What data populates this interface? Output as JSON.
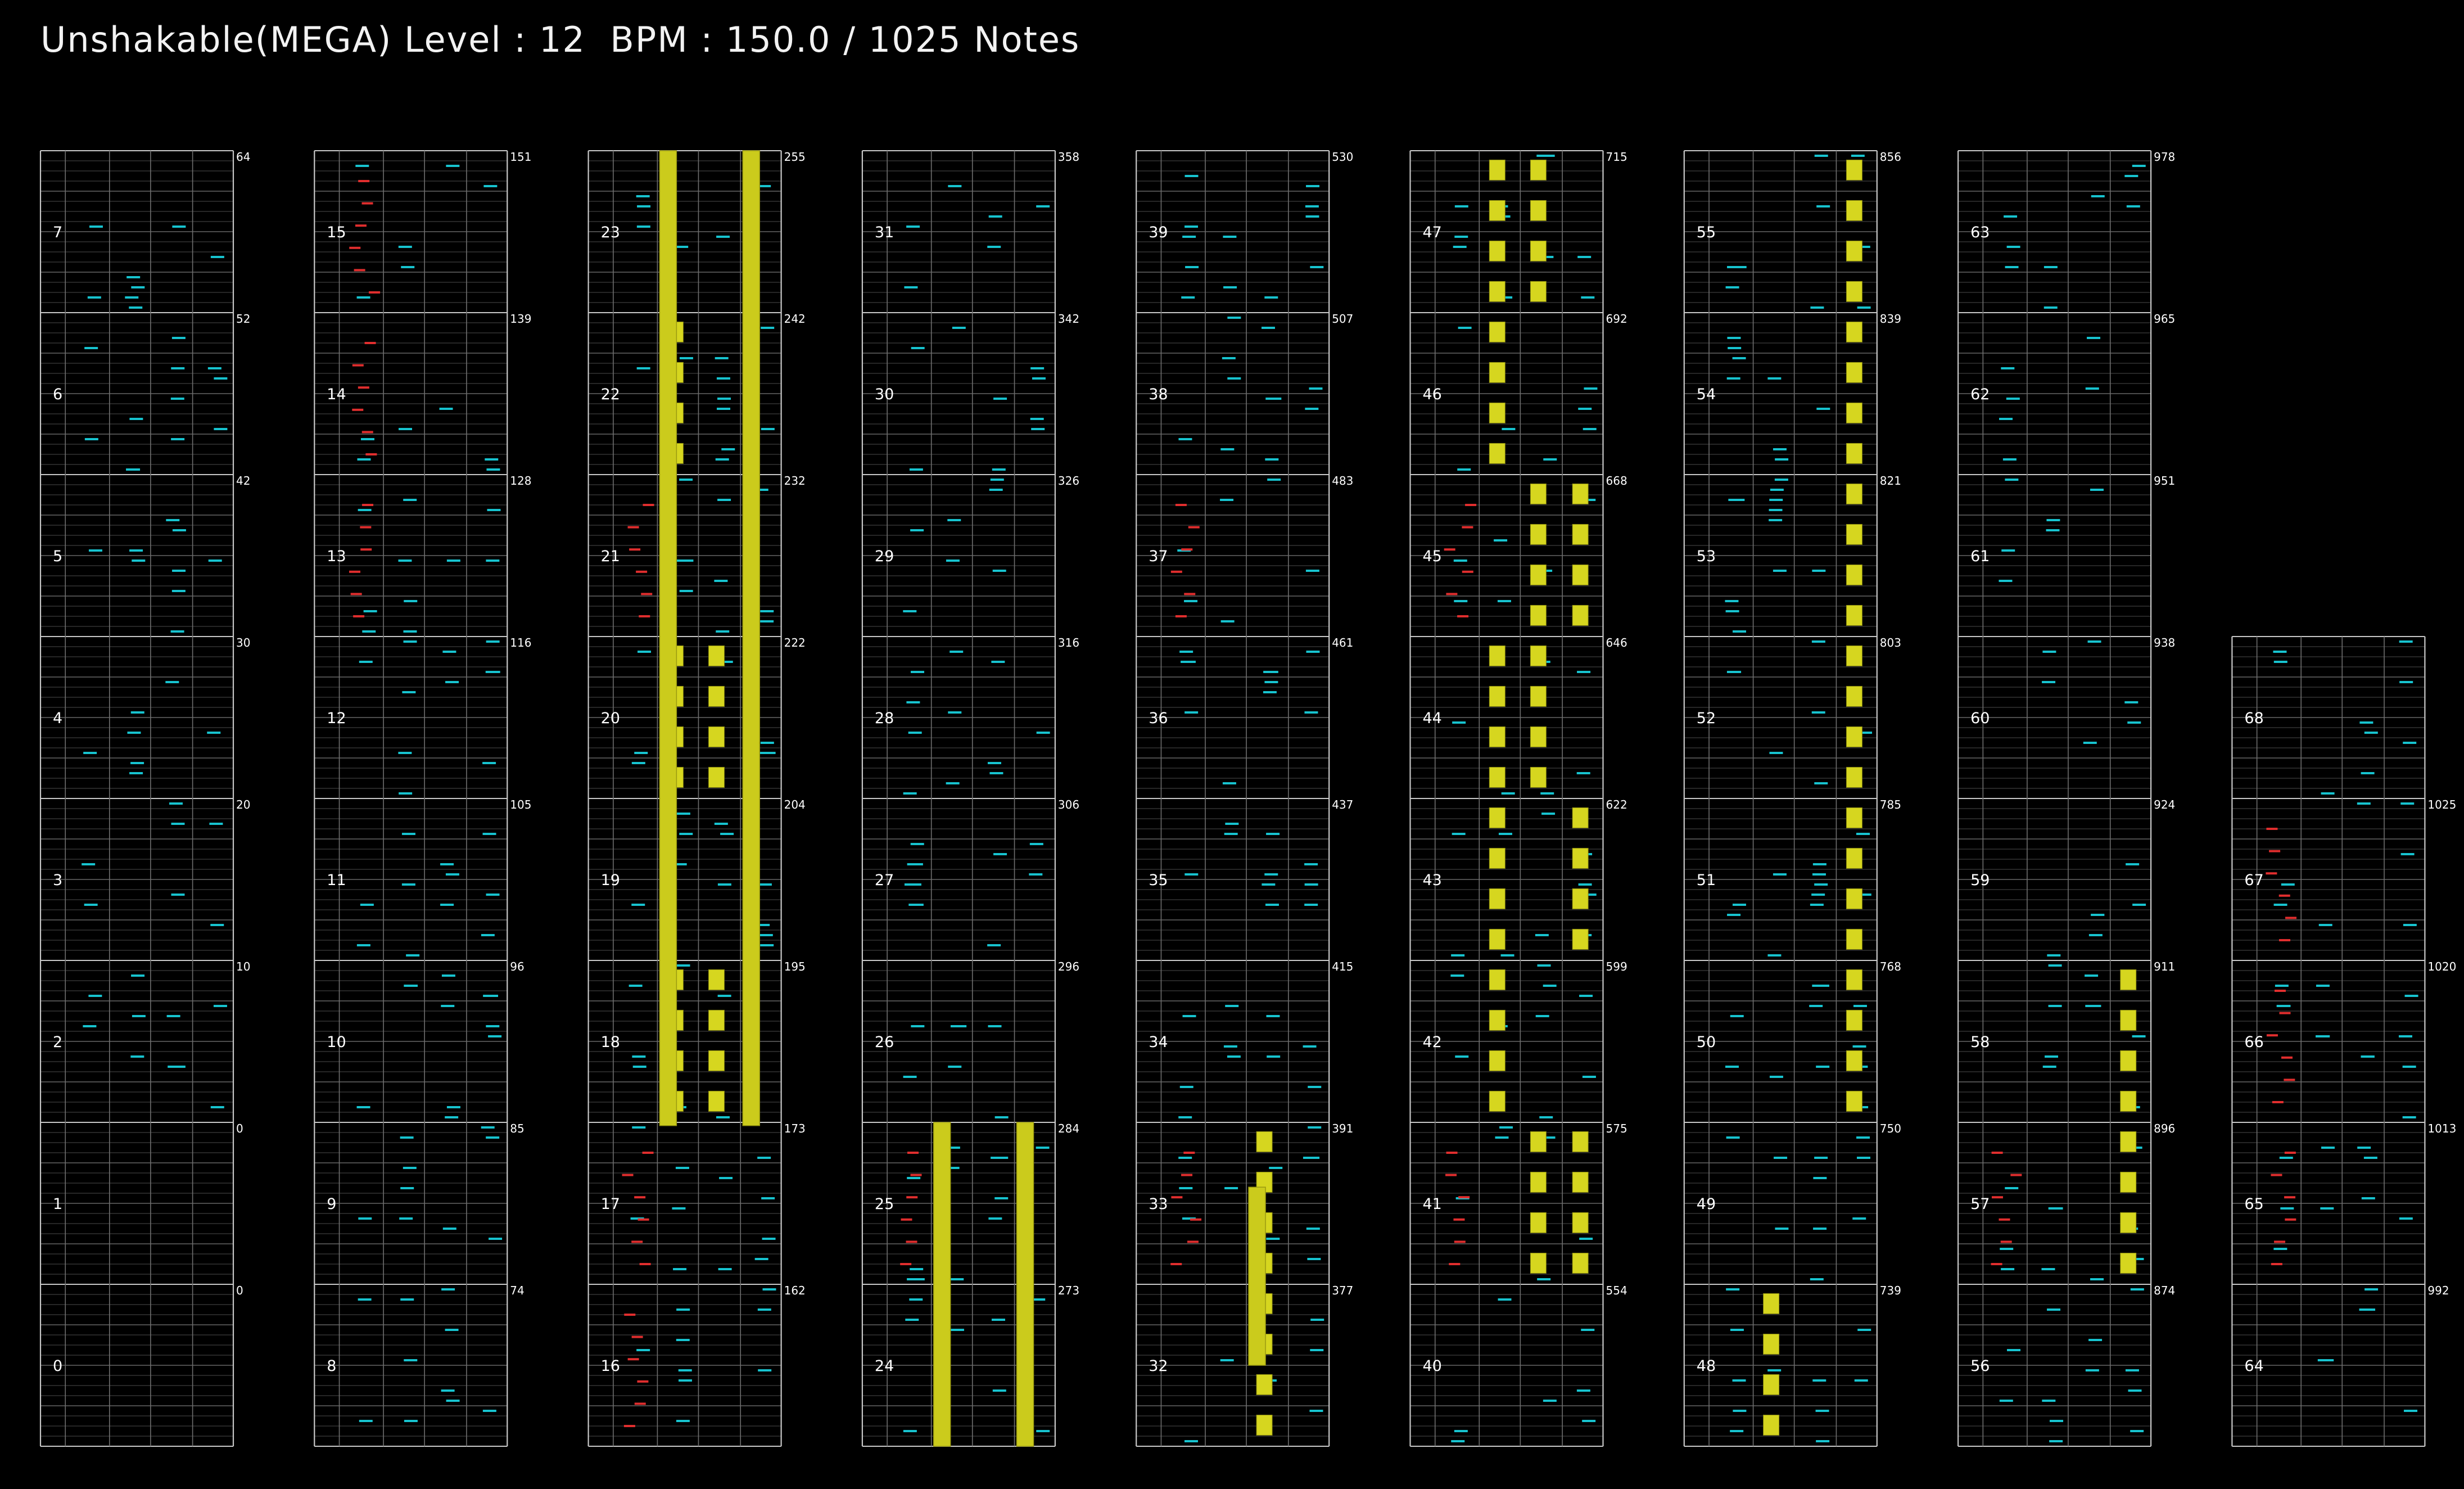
{
  "header": {
    "title": "Unshakable(MEGA) Level : 12  BPM : 150.0 / 1025 Notes",
    "song": "Unshakable(MEGA)",
    "level": 12,
    "bpm": "150.0",
    "total_notes": 1025
  },
  "colors": {
    "background": "#000000",
    "frame": "#c8c8c8",
    "beat_line": "#7a7a7a",
    "sub_line": "#3c3c3c",
    "lane_line": "#6e6e6e",
    "tap_note": "#17c3cf",
    "scratch_note": "#e02e2e",
    "long_note": "#cbcb1c",
    "landmine": "#d6d61f"
  },
  "measure_counts": [
    0,
    0,
    10,
    20,
    30,
    42,
    52,
    64,
    74,
    85,
    96,
    105,
    116,
    128,
    139,
    151,
    162,
    173,
    195,
    204,
    222,
    232,
    242,
    255,
    273,
    284,
    296,
    306,
    316,
    326,
    342,
    358,
    377,
    391,
    415,
    437,
    461,
    483,
    507,
    530,
    554,
    575,
    599,
    622,
    646,
    668,
    692,
    715,
    739,
    750,
    768,
    785,
    803,
    821,
    839,
    856,
    874,
    896,
    911,
    924,
    938,
    951,
    965,
    978,
    992,
    1013,
    1020,
    1025
  ],
  "columns": [
    {
      "index": 0,
      "measures": [
        0,
        1,
        2,
        3,
        4,
        5,
        6,
        7
      ]
    },
    {
      "index": 1,
      "measures": [
        8,
        9,
        10,
        11,
        12,
        13,
        14,
        15
      ]
    },
    {
      "index": 2,
      "measures": [
        16,
        17,
        18,
        19,
        20,
        21,
        22,
        23
      ]
    },
    {
      "index": 3,
      "measures": [
        24,
        25,
        26,
        27,
        28,
        29,
        30,
        31
      ]
    },
    {
      "index": 4,
      "measures": [
        32,
        33,
        34,
        35,
        36,
        37,
        38,
        39
      ]
    },
    {
      "index": 5,
      "measures": [
        40,
        41,
        42,
        43,
        44,
        45,
        46,
        47
      ]
    },
    {
      "index": 6,
      "measures": [
        48,
        49,
        50,
        51,
        52,
        53,
        54,
        55
      ]
    },
    {
      "index": 7,
      "measures": [
        56,
        57,
        58,
        59,
        60,
        61,
        62,
        63
      ]
    },
    {
      "index": 8,
      "measures": [
        64,
        65,
        66,
        67,
        68
      ]
    }
  ],
  "chart_data": {
    "type": "rhythm-game-notechart",
    "measures_per_column": 8,
    "total_measures": 69,
    "long_notes": [
      {
        "column": 2,
        "lane": 2,
        "from_measure": 17.98,
        "to_measure": 24.0
      },
      {
        "column": 2,
        "lane": 4,
        "from_measure": 17.98,
        "to_measure": 24.0
      },
      {
        "column": 3,
        "lane": 2,
        "from_measure": 24.0,
        "to_measure": 26.0
      },
      {
        "column": 3,
        "lane": 4,
        "from_measure": 24.0,
        "to_measure": 26.0
      },
      {
        "column": 4,
        "lane": 3,
        "from_measure": 32.5,
        "to_measure": 33.6
      }
    ]
  }
}
